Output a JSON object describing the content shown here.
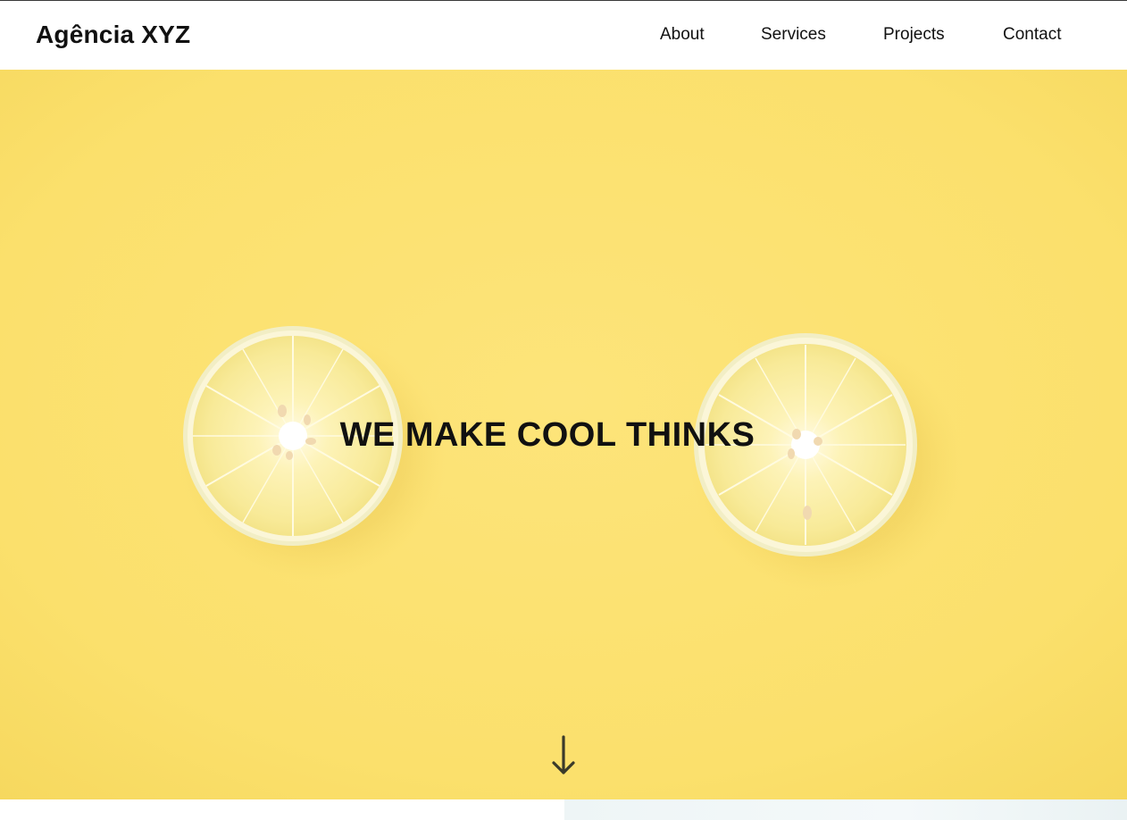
{
  "header": {
    "brand": "Agência XYZ",
    "nav": [
      {
        "label": "About"
      },
      {
        "label": "Services"
      },
      {
        "label": "Projects"
      },
      {
        "label": "Contact"
      }
    ]
  },
  "hero": {
    "title": "WE MAKE COOL THINKS",
    "background_color": "#fbe06e",
    "image_subject": "two lemon slices on yellow background",
    "scroll_icon": "arrow-down-icon"
  },
  "colors": {
    "text": "#111111",
    "header_bg": "#ffffff",
    "hero_yellow": "#fbe06e",
    "lemon_pulp": "#fdf0a8",
    "lemon_rind": "#f3f0c9"
  }
}
